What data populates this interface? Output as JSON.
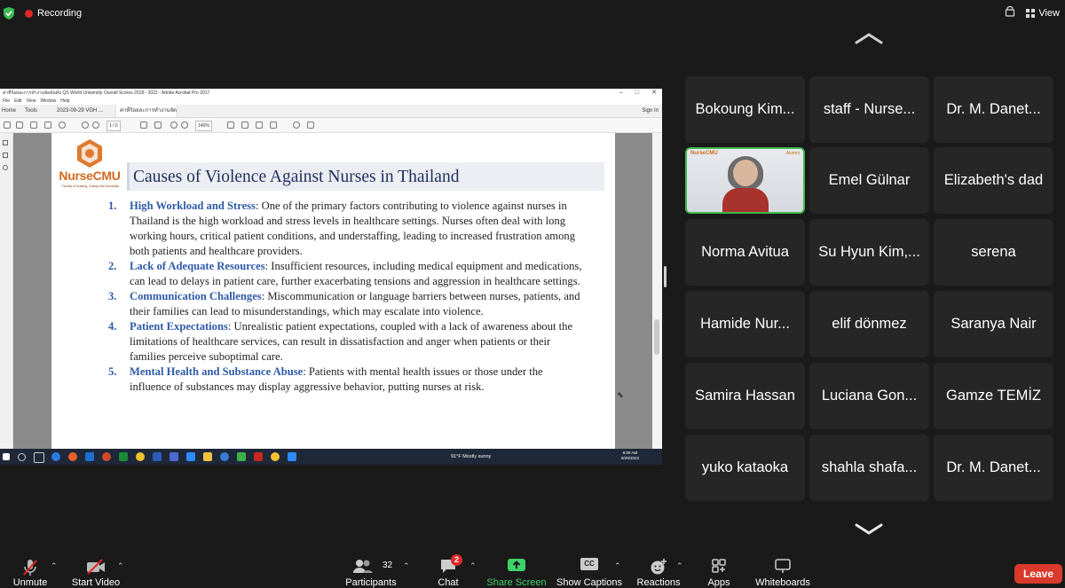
{
  "topbar": {
    "recording_label": "Recording",
    "view_label": "View"
  },
  "colors": {
    "recording": "#e02828",
    "shield": "#3fb950",
    "share_screen": "#3fd16a",
    "leave": "#d93a2b",
    "slide_heading": "#2e5aa8",
    "slide_title": "#1f2e5c"
  },
  "shared_screen": {
    "window_title": "ค่าที่ร้อยละการทำงานจัดอันดับ QS World University Overall Scores 2018 - 2022 - Adobe Acrobat Pro 2017",
    "menu": [
      "File",
      "Edit",
      "View",
      "Window",
      "Help"
    ],
    "tabs": [
      "Home",
      "Tools",
      "2023-09-29 VGH ...",
      "ค่าที่ร้อยละการทำงานจัดอันดับ..."
    ],
    "sign_in": "Sign In",
    "page_indicator": "1 / 6",
    "zoom": "140%",
    "logo_text": "NurseCMU",
    "logo_sub": "Faculty of Nursing, Chiang Mai University",
    "slide_title": "Causes of Violence Against Nurses in Thailand",
    "items": [
      {
        "num": "1.",
        "heading": "High Workload and Stress",
        "text": ": One of the primary factors contributing to violence against nurses in Thailand is the high workload and stress levels in healthcare settings. Nurses often deal with long working hours, critical patient conditions, and understaffing, leading to increased frustration among both patients and healthcare providers."
      },
      {
        "num": "2.",
        "heading": "Lack of Adequate Resources",
        "text": ": Insufficient resources, including medical equipment and medications, can lead to delays in patient care, further exacerbating tensions and aggression in healthcare settings."
      },
      {
        "num": "3.",
        "heading": "Communication Challenges",
        "text": ": Miscommunication or language barriers between nurses, patients, and their families can lead to misunderstandings, which may escalate into violence."
      },
      {
        "num": "4.",
        "heading": "Patient Expectations",
        "text": ": Unrealistic patient expectations, coupled with a lack of awareness about the limitations of healthcare services, can result in dissatisfaction and anger when patients or their families perceive suboptimal care."
      },
      {
        "num": "5.",
        "heading": "Mental Health and Substance Abuse",
        "text": ": Patients with mental health issues or those under the influence of substances may display aggressive behavior, putting nurses at risk."
      }
    ],
    "taskbar": {
      "weather": "91°F  Mostly sunny",
      "time": "8:09 AM",
      "date": "9/29/2023"
    }
  },
  "gallery": {
    "participants": [
      {
        "name": "Bokoung Kim..."
      },
      {
        "name": "staff - Nurse..."
      },
      {
        "name": "Dr. M. Danet..."
      },
      {
        "name": "",
        "video": true,
        "video_logo": "NurseCMU",
        "video_badge": "Alumni"
      },
      {
        "name": "Emel Gülnar"
      },
      {
        "name": "Elizabeth's dad"
      },
      {
        "name": "Norma Avitua"
      },
      {
        "name": "Su Hyun Kim,..."
      },
      {
        "name": "serena"
      },
      {
        "name": "Hamide Nur..."
      },
      {
        "name": "elif dönmez"
      },
      {
        "name": "Saranya Nair"
      },
      {
        "name": "Samira Hassan"
      },
      {
        "name": "Luciana Gon..."
      },
      {
        "name": "Gamze TEMİZ"
      },
      {
        "name": "yuko kataoka"
      },
      {
        "name": "shahla shafa..."
      },
      {
        "name": "Dr. M. Danet..."
      }
    ]
  },
  "toolbar": {
    "unmute": "Unmute",
    "start_video": "Start Video",
    "participants": "Participants",
    "participants_count": "32",
    "chat": "Chat",
    "chat_badge": "2",
    "share_screen": "Share Screen",
    "captions": "Show Captions",
    "captions_icon_text": "CC",
    "reactions": "Reactions",
    "apps": "Apps",
    "whiteboards": "Whiteboards",
    "leave": "Leave"
  }
}
